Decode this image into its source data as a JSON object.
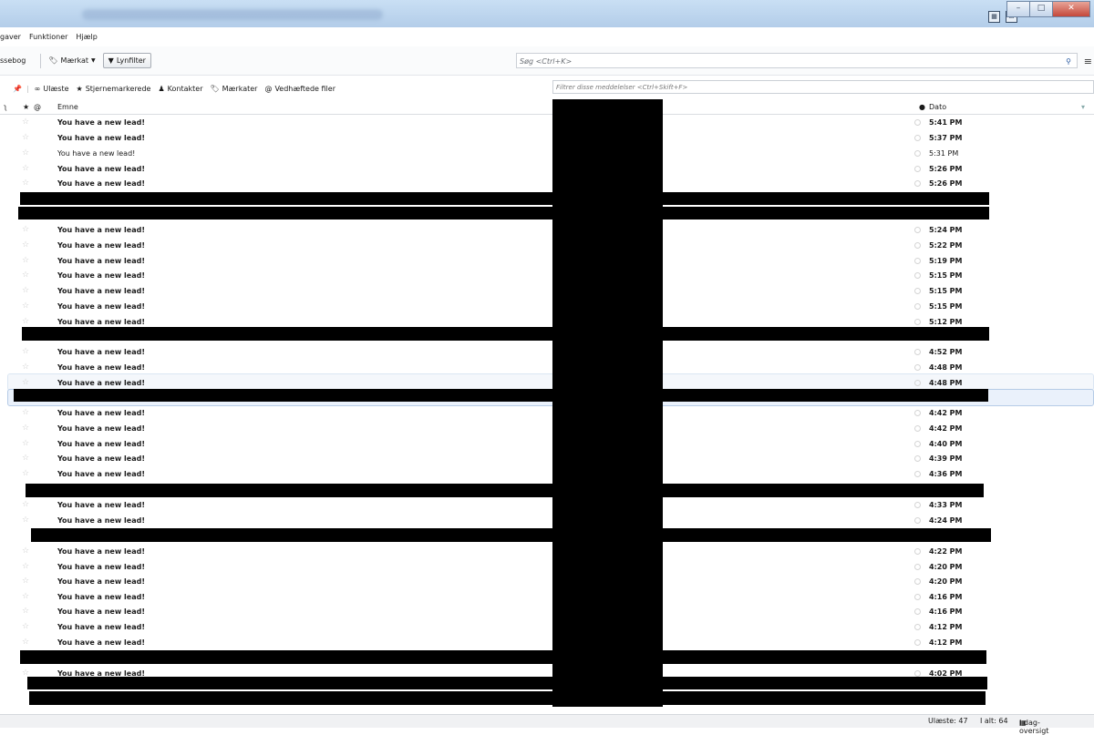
{
  "menu": {
    "items": [
      "gaver",
      "Funktioner",
      "Hjælp"
    ]
  },
  "toolbar": {
    "addressbook": "ssebog",
    "tag": "Mærkat",
    "quickfilter": "Lynfilter"
  },
  "search": {
    "placeholder": "Søg <Ctrl+K>"
  },
  "filterbar": {
    "unread": "Ulæste",
    "starred": "Stjernemarkerede",
    "contacts": "Kontakter",
    "tags": "Mærkater",
    "attachments": "Vedhæftede filer",
    "placeholder": "Filtrer disse meddelelser <Ctrl+Skift+F>"
  },
  "columns": {
    "subject": "Emne",
    "date": "Dato"
  },
  "messages": [
    {
      "subject": "You have a new lead!",
      "date": "5:41 PM",
      "unread": true
    },
    {
      "subject": "You have a new lead!",
      "date": "5:37 PM",
      "unread": true
    },
    {
      "subject": "You have a new lead!",
      "date": "5:31 PM",
      "unread": false
    },
    {
      "subject": "You have a new lead!",
      "date": "5:26 PM",
      "unread": true
    },
    {
      "subject": "You have a new lead!",
      "date": "5:26 PM",
      "unread": true
    },
    {
      "subject": "You have a new lead!",
      "date": "5:24 PM",
      "unread": true
    },
    {
      "subject": "You have a new lead!",
      "date": "5:22 PM",
      "unread": true
    },
    {
      "subject": "You have a new lead!",
      "date": "5:19 PM",
      "unread": true
    },
    {
      "subject": "You have a new lead!",
      "date": "5:15 PM",
      "unread": true
    },
    {
      "subject": "You have a new lead!",
      "date": "5:15 PM",
      "unread": true
    },
    {
      "subject": "You have a new lead!",
      "date": "5:15 PM",
      "unread": true
    },
    {
      "subject": "You have a new lead!",
      "date": "5:12 PM",
      "unread": true
    },
    {
      "subject": "You have a new lead!",
      "date": "4:52 PM",
      "unread": true
    },
    {
      "subject": "You have a new lead!",
      "date": "4:48 PM",
      "unread": true
    },
    {
      "subject": "You have a new lead!",
      "date": "4:48 PM",
      "unread": true
    },
    {
      "subject": "You have a new lead!",
      "date": "4:42 PM",
      "unread": true
    },
    {
      "subject": "You have a new lead!",
      "date": "4:42 PM",
      "unread": true
    },
    {
      "subject": "You have a new lead!",
      "date": "4:40 PM",
      "unread": true
    },
    {
      "subject": "You have a new lead!",
      "date": "4:39 PM",
      "unread": true
    },
    {
      "subject": "You have a new lead!",
      "date": "4:36 PM",
      "unread": true
    },
    {
      "subject": "You have a new lead!",
      "date": "4:33 PM",
      "unread": true
    },
    {
      "subject": "You have a new lead!",
      "date": "4:24 PM",
      "unread": true
    },
    {
      "subject": "You have a new lead!",
      "date": "4:22 PM",
      "unread": true
    },
    {
      "subject": "You have a new lead!",
      "date": "4:20 PM",
      "unread": true
    },
    {
      "subject": "You have a new lead!",
      "date": "4:20 PM",
      "unread": true
    },
    {
      "subject": "You have a new lead!",
      "date": "4:16 PM",
      "unread": true
    },
    {
      "subject": "You have a new lead!",
      "date": "4:16 PM",
      "unread": true
    },
    {
      "subject": "You have a new lead!",
      "date": "4:12 PM",
      "unread": true
    },
    {
      "subject": "You have a new lead!",
      "date": "4:12 PM",
      "unread": true
    },
    {
      "subject": "You have a new lead!",
      "date": "4:02 PM",
      "unread": true
    }
  ],
  "status": {
    "unread": "Ulæste: 47",
    "total": "I alt: 64",
    "today": "I dag-oversigt"
  },
  "colors": {
    "titlebar": "#b3cde9",
    "selection": "#eaf1fb",
    "redaction": "#000000"
  }
}
